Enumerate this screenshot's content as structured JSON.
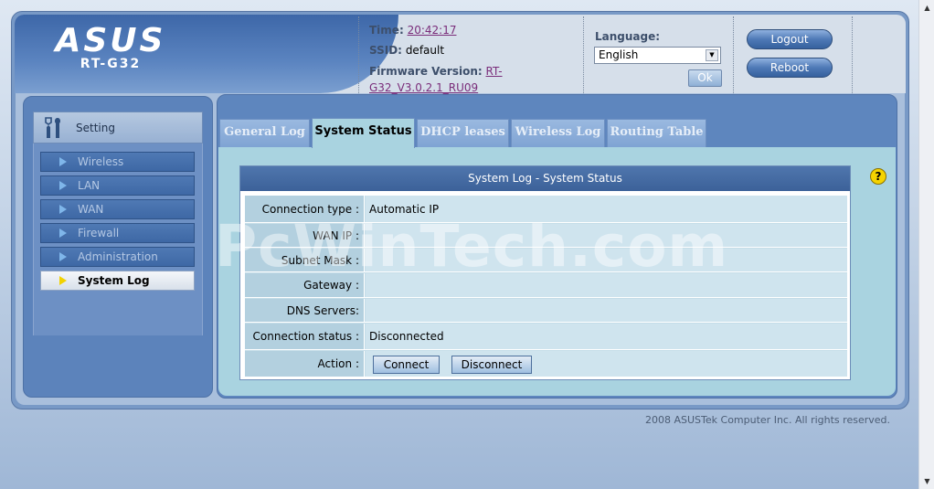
{
  "brand": {
    "logo": "ASUS",
    "model": "RT-G32"
  },
  "status": {
    "time_label": "Time:",
    "time_value": "20:42:17",
    "ssid_label": "SSID:",
    "ssid_value": "default",
    "firmware_label": "Firmware Version:",
    "firmware_value_line1": "RT-",
    "firmware_value_line2": "G32_V3.0.2.1_RU09"
  },
  "language": {
    "label": "Language:",
    "selected": "English",
    "ok_label": "Ok"
  },
  "header_buttons": {
    "logout": "Logout",
    "reboot": "Reboot"
  },
  "sidebar": {
    "heading": "Setting",
    "items": [
      {
        "label": "Wireless",
        "active": false
      },
      {
        "label": "LAN",
        "active": false
      },
      {
        "label": "WAN",
        "active": false
      },
      {
        "label": "Firewall",
        "active": false
      },
      {
        "label": "Administration",
        "active": false
      },
      {
        "label": "System Log",
        "active": true
      }
    ]
  },
  "tabs": [
    {
      "label": "General Log",
      "active": false
    },
    {
      "label": "System Status",
      "active": true
    },
    {
      "label": "DHCP leases",
      "active": false
    },
    {
      "label": "Wireless Log",
      "active": false
    },
    {
      "label": "Routing Table",
      "active": false
    }
  ],
  "panel": {
    "title": "System Log - System Status",
    "rows": [
      {
        "label": "Connection type :",
        "value": "Automatic IP"
      },
      {
        "label": "WAN IP :",
        "value": ""
      },
      {
        "label": "Subnet Mask :",
        "value": ""
      },
      {
        "label": "Gateway :",
        "value": ""
      },
      {
        "label": "DNS Servers:",
        "value": ""
      },
      {
        "label": "Connection status :",
        "value": "Disconnected"
      }
    ],
    "action_label": "Action :",
    "connect_label": "Connect",
    "disconnect_label": "Disconnect"
  },
  "help_icon": "?",
  "watermark": "PcWinTech.com",
  "footer": {
    "copyright": "2008 ASUSTek Computer Inc. All rights reserved."
  },
  "colors": {
    "accent": "#5e86be",
    "content_bg": "#a9d3e0",
    "title_bar": "#3c6199"
  }
}
